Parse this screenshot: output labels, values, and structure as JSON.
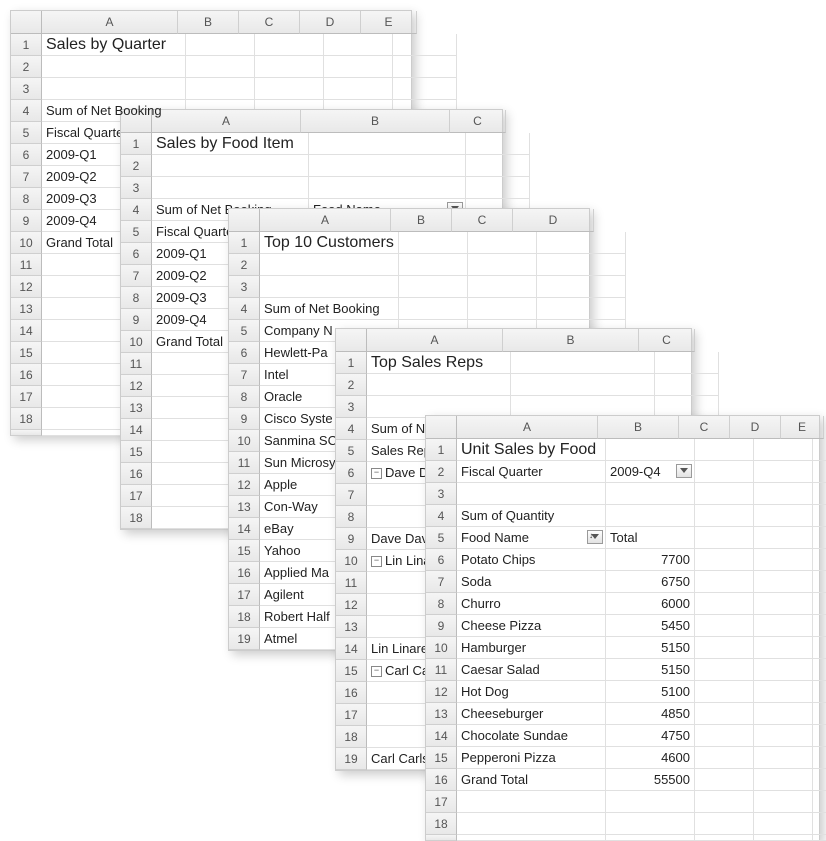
{
  "sheet1": {
    "title": "Sales by Quarter",
    "cols": [
      "A",
      "B",
      "C",
      "D",
      "E"
    ],
    "widths": [
      135,
      60,
      60,
      60,
      55
    ],
    "r4a": "Sum of Net Booking",
    "r5a": "Fiscal Quarter",
    "rows": [
      "2009-Q1",
      "2009-Q2",
      "2009-Q3",
      "2009-Q4",
      "Grand Total"
    ]
  },
  "sheet2": {
    "title": "Sales by Food Item",
    "cols": [
      "A",
      "B",
      "C"
    ],
    "widths": [
      148,
      148,
      55
    ],
    "r4a": "Sum of Net Booking",
    "r4b": "Food Name",
    "r5a": "Fiscal Quarter",
    "rows": [
      "2009-Q1",
      "2009-Q2",
      "2009-Q3",
      "2009-Q4",
      "Grand Total"
    ]
  },
  "sheet3": {
    "title": "Top 10 Customers",
    "cols": [
      "A",
      "B",
      "C",
      "D"
    ],
    "widths": [
      130,
      60,
      60,
      80
    ],
    "r4a": "Sum of Net Booking",
    "r5a": "Company N",
    "rows": [
      "Hewlett-Pa",
      "Intel",
      "Oracle",
      "Cisco Syste",
      "Sanmina SC",
      "Sun Microsy",
      "Apple",
      "Con-Way",
      "eBay",
      "Yahoo",
      "Applied Ma",
      "Agilent",
      "Robert Half",
      "Atmel"
    ]
  },
  "sheet4": {
    "title": "Top Sales Reps",
    "cols": [
      "A",
      "B",
      "C"
    ],
    "widths": [
      135,
      135,
      55
    ],
    "r4a": "Sum of Net Bookings",
    "r5a": "Sales Rep N",
    "rows": [
      "Dave Dav",
      "",
      "",
      "Dave Davids",
      "Lin Linare",
      "",
      "",
      "",
      "Lin Linares T",
      "Carl Carlso",
      "",
      "",
      "",
      "Carl Carlson"
    ]
  },
  "sheet5": {
    "title": "Unit Sales by Food",
    "cols": [
      "A",
      "B",
      "C",
      "D",
      "E"
    ],
    "widths": [
      140,
      80,
      50,
      50,
      42
    ],
    "r2a": "Fiscal Quarter",
    "r2b": "2009-Q4",
    "r4a": "Sum of Quantity",
    "r5a": "Food Name",
    "r5b": "Total",
    "chart_data": {
      "type": "table",
      "title": "Unit Sales by Food",
      "filter": {
        "Fiscal Quarter": "2009-Q4"
      },
      "series": [
        {
          "name": "Potato Chips",
          "value": 7700
        },
        {
          "name": "Soda",
          "value": 6750
        },
        {
          "name": "Churro",
          "value": 6000
        },
        {
          "name": "Cheese Pizza",
          "value": 5450
        },
        {
          "name": "Hamburger",
          "value": 5150
        },
        {
          "name": "Caesar Salad",
          "value": 5150
        },
        {
          "name": "Hot Dog",
          "value": 5100
        },
        {
          "name": "Cheeseburger",
          "value": 4850
        },
        {
          "name": "Chocolate Sundae",
          "value": 4750
        },
        {
          "name": "Pepperoni Pizza",
          "value": 4600
        }
      ],
      "grand_total": 55500
    }
  }
}
